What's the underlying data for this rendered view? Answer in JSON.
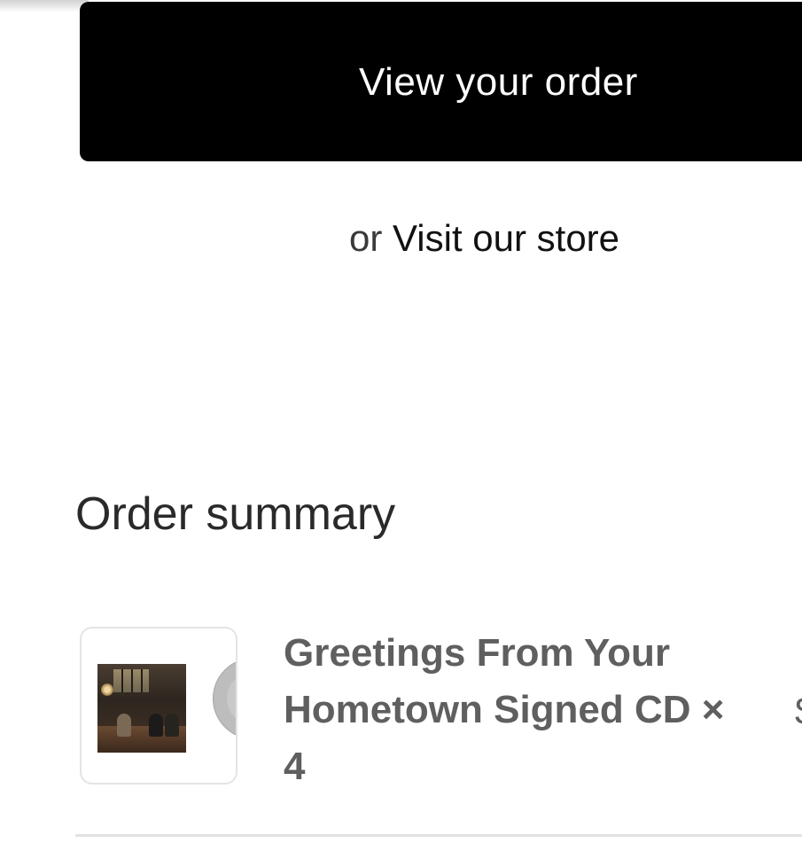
{
  "primary_action": {
    "label": "View your order"
  },
  "secondary_action": {
    "prefix": "or",
    "link_label": "Visit our store"
  },
  "order_summary": {
    "title": "Order summary",
    "items": [
      {
        "name": "Greetings From Your Hometown Signed CD",
        "quantity_text": "× 4"
      }
    ],
    "cut_off_price_glyph": "$"
  },
  "colors": {
    "button_background": "#000000",
    "button_text": "#ffffff",
    "product_text": "#5f5f5f",
    "divider": "#e2e2e2"
  }
}
